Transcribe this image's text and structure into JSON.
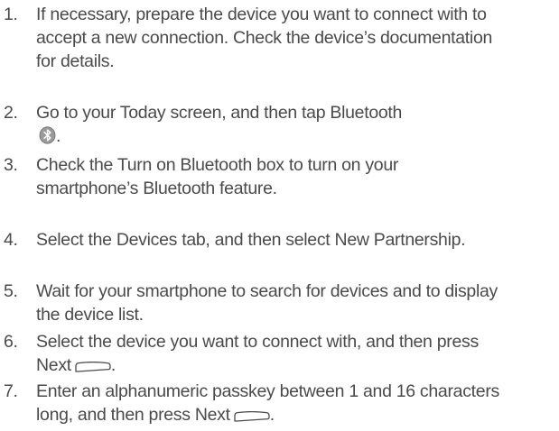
{
  "steps": [
    {
      "number": "1.",
      "lines": [
        "If necessary, prepare the device you want to connect with to",
        "accept a new connection. Check the device’s documentation",
        "for details."
      ]
    },
    {
      "number": "2.",
      "text": "Go to your Today screen, and then tap Bluetooth",
      "icon": "bluetooth-icon",
      "suffix": "."
    },
    {
      "number": "3.",
      "lines": [
        "Check the Turn on Bluetooth box to turn on your",
        "smartphone’s Bluetooth feature."
      ]
    },
    {
      "number": "4.",
      "lines": [
        "Select the Devices tab, and then select New Partnership."
      ]
    },
    {
      "number": "5.",
      "lines": [
        "Wait for your smartphone to search for devices and to display",
        "the device list."
      ]
    },
    {
      "number": "6.",
      "line1": "Select the device you want to connect with, and then press",
      "line2": "Next",
      "icon": "left-softkey-icon",
      "suffix": "."
    },
    {
      "number": "7.",
      "line1": "Enter an alphanumeric passkey between 1 and 16 characters",
      "line2": "long, and then press Next",
      "icon": "left-softkey-icon",
      "suffix": "."
    }
  ]
}
